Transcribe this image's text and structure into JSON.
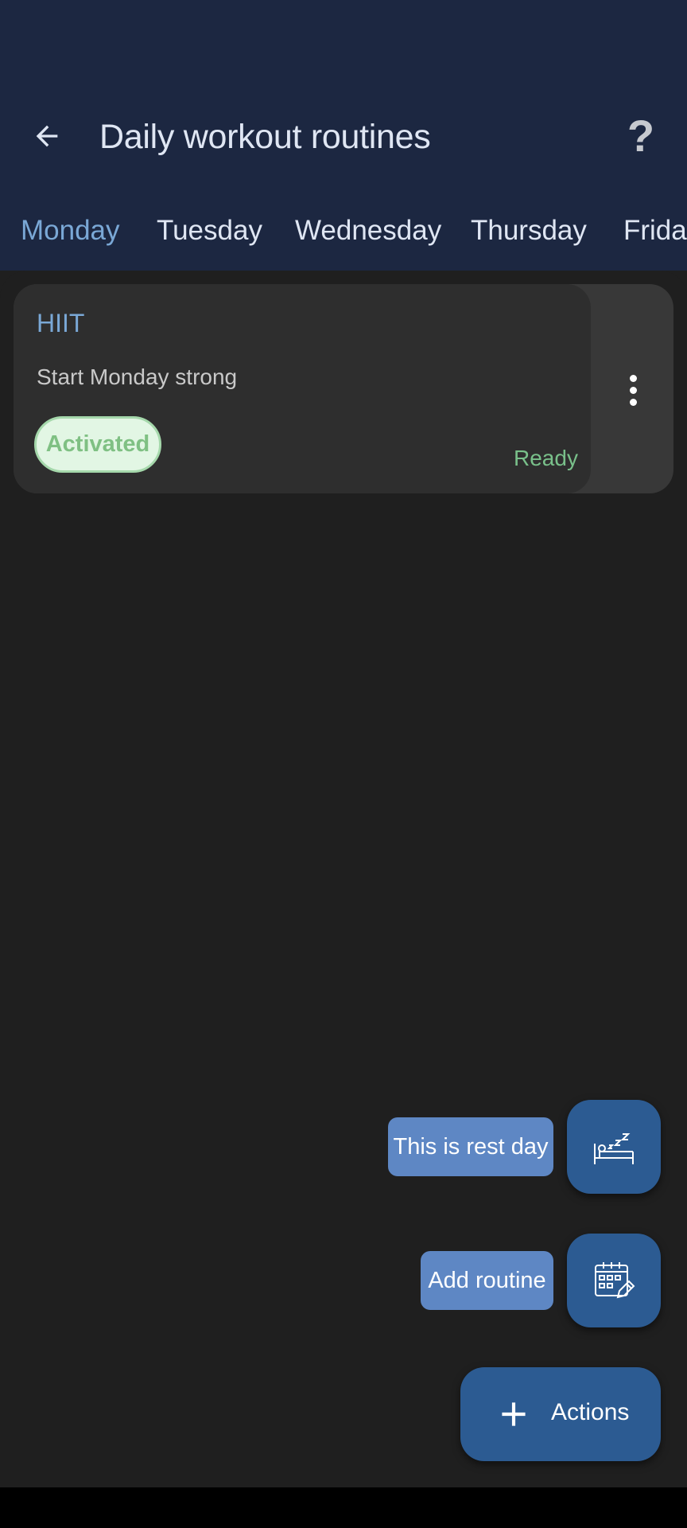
{
  "header": {
    "title": "Daily workout routines",
    "back_icon": "arrow-left-icon",
    "help_label": "?"
  },
  "tabs": [
    {
      "label": "Monday",
      "active": true
    },
    {
      "label": "Tuesday",
      "active": false
    },
    {
      "label": "Wednesday",
      "active": false
    },
    {
      "label": "Thursday",
      "active": false
    },
    {
      "label": "Friday",
      "active": false
    }
  ],
  "routine": {
    "title": "HIIT",
    "description": "Start Monday strong",
    "badge": "Activated",
    "status": "Ready",
    "menu_icon": "more-vert-icon"
  },
  "actions": {
    "rest_day_label": "This is rest day",
    "rest_day_icon": "bed-sleep-icon",
    "add_routine_label": "Add routine",
    "add_routine_icon": "calendar-edit-icon",
    "main_label": "Actions",
    "main_icon": "plus-icon"
  },
  "colors": {
    "appbar": "#1c2741",
    "accent": "#7aa8d6",
    "fab": "#2c5b92",
    "chip": "#5e87c4",
    "badge_bg": "#e2f6e4",
    "ready": "#79c08a"
  }
}
